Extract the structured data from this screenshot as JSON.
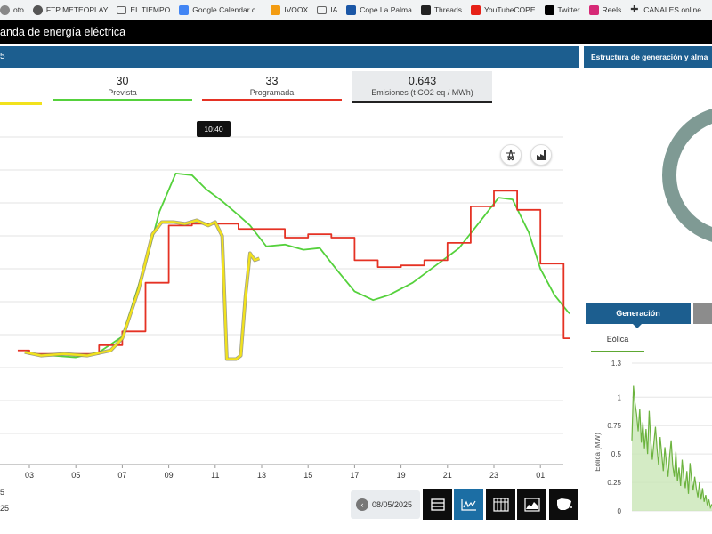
{
  "bookmarks": [
    {
      "label": "oto",
      "icon": "globe-icon",
      "color": "#888888"
    },
    {
      "label": "FTP METEOPLAY",
      "icon": "globe-icon",
      "color": "#555555"
    },
    {
      "label": "EL TIEMPO",
      "icon": "folder-icon",
      "color": "#666666"
    },
    {
      "label": "Google Calendar c...",
      "icon": "calendar-icon",
      "color": "#4285f4"
    },
    {
      "label": "IVOOX",
      "icon": "ivoox-icon",
      "color": "#f39c12"
    },
    {
      "label": "IA",
      "icon": "folder-icon",
      "color": "#666666"
    },
    {
      "label": "Cope La Palma",
      "icon": "cope-icon",
      "color": "#1a56a6"
    },
    {
      "label": "Threads",
      "icon": "threads-icon",
      "color": "#222222"
    },
    {
      "label": "YouTubeCOPE",
      "icon": "youtube-icon",
      "color": "#e62117"
    },
    {
      "label": "Twitter",
      "icon": "x-icon",
      "color": "#000000"
    },
    {
      "label": "Reels",
      "icon": "instagram-icon",
      "color": "#d62976"
    },
    {
      "label": "CANALES online",
      "icon": "plus-icon",
      "color": "#222222"
    }
  ],
  "header": {
    "title": "anda de energía eléctrica",
    "subtitle": "5",
    "right_panel_title": "Estructura de generación y alma"
  },
  "metrics": {
    "real": {
      "value": "",
      "label": "",
      "color": "#f2e21d"
    },
    "prevista": {
      "value": "30",
      "label": "Prevista",
      "color": "#55d13c"
    },
    "programada": {
      "value": "33",
      "label": "Programada",
      "color": "#e53224"
    },
    "emisiones": {
      "value": "0.643",
      "label": "Emisiones (t CO2 eq / MWh)",
      "color": "#222222"
    }
  },
  "tooltip": "10:40",
  "colors": {
    "real": "#f2e21d",
    "real_dark": "#8a8a6a",
    "prevista": "#55d13c",
    "programada": "#e53224",
    "navy": "#1c5e8f",
    "donut": "#7f9a94",
    "eolica": "#6cb33f"
  },
  "chart_data": [
    {
      "type": "line",
      "x_ticks": [
        "03",
        "05",
        "07",
        "09",
        "11",
        "13",
        "15",
        "17",
        "19",
        "21",
        "23",
        "01"
      ],
      "grid": true,
      "series": [
        {
          "name": "Prevista",
          "color": "#55d13c",
          "points": [
            [
              1.0,
              0.73
            ],
            [
              2.0,
              0.72
            ],
            [
              3.0,
              0.71
            ],
            [
              4.0,
              0.74
            ],
            [
              5.0,
              0.83
            ],
            [
              6.0,
              1.25
            ],
            [
              6.6,
              1.55
            ],
            [
              7.3,
              1.77
            ],
            [
              8.0,
              1.76
            ],
            [
              8.6,
              1.68
            ],
            [
              9.3,
              1.61
            ],
            [
              10.0,
              1.53
            ],
            [
              10.5,
              1.47
            ],
            [
              11.2,
              1.35
            ],
            [
              12.0,
              1.36
            ],
            [
              12.8,
              1.33
            ],
            [
              13.5,
              1.34
            ],
            [
              14.2,
              1.22
            ],
            [
              15.0,
              1.09
            ],
            [
              15.8,
              1.04
            ],
            [
              16.5,
              1.07
            ],
            [
              17.5,
              1.14
            ],
            [
              18.5,
              1.24
            ],
            [
              19.5,
              1.34
            ],
            [
              20.5,
              1.51
            ],
            [
              21.2,
              1.63
            ],
            [
              21.8,
              1.62
            ],
            [
              22.5,
              1.43
            ],
            [
              23.0,
              1.22
            ],
            [
              23.6,
              1.07
            ],
            [
              24.2,
              0.97
            ],
            [
              25.0,
              0.89
            ],
            [
              25.5,
              0.83
            ],
            [
              26.0,
              0.78
            ]
          ]
        },
        {
          "name": "Programada",
          "color": "#e53224",
          "step": true,
          "points": [
            [
              0.5,
              0.75
            ],
            [
              1.0,
              0.73
            ],
            [
              4.0,
              0.78
            ],
            [
              5.0,
              0.86
            ],
            [
              6.0,
              1.14
            ],
            [
              7.0,
              1.47
            ],
            [
              8.0,
              1.48
            ],
            [
              9.0,
              1.48
            ],
            [
              10.0,
              1.45
            ],
            [
              12.0,
              1.4
            ],
            [
              13.0,
              1.42
            ],
            [
              14.0,
              1.4
            ],
            [
              15.0,
              1.27
            ],
            [
              16.0,
              1.23
            ],
            [
              17.0,
              1.24
            ],
            [
              18.0,
              1.27
            ],
            [
              19.0,
              1.37
            ],
            [
              20.0,
              1.58
            ],
            [
              21.0,
              1.67
            ],
            [
              22.0,
              1.56
            ],
            [
              23.0,
              1.25
            ],
            [
              24.0,
              0.82
            ],
            [
              25.0,
              0.67
            ],
            [
              26.0,
              0.65
            ]
          ]
        },
        {
          "name": "Real",
          "color": "#f2e21d",
          "points": [
            [
              0.8,
              0.74
            ],
            [
              1.5,
              0.72
            ],
            [
              2.5,
              0.73
            ],
            [
              3.5,
              0.72
            ],
            [
              4.5,
              0.75
            ],
            [
              5.0,
              0.82
            ],
            [
              5.7,
              1.1
            ],
            [
              6.3,
              1.42
            ],
            [
              6.7,
              1.49
            ],
            [
              7.2,
              1.49
            ],
            [
              7.7,
              1.48
            ],
            [
              8.2,
              1.5
            ],
            [
              8.7,
              1.47
            ],
            [
              9.0,
              1.49
            ],
            [
              9.3,
              1.41
            ],
            [
              9.5,
              0.7
            ],
            [
              9.9,
              0.7
            ],
            [
              10.1,
              0.72
            ],
            [
              10.3,
              1.06
            ],
            [
              10.5,
              1.31
            ],
            [
              10.7,
              1.27
            ],
            [
              10.9,
              1.28
            ]
          ]
        }
      ]
    },
    {
      "type": "area",
      "y_ticks": [
        "1.3",
        "1",
        "0.75",
        "0.5",
        "0.25",
        "0"
      ],
      "ylabel": "Eólica (MW)",
      "ylim": [
        0,
        1.3
      ],
      "series": [
        {
          "name": "Eólica",
          "color": "#6cb33f",
          "values": [
            0.62,
            1.1,
            0.95,
            0.85,
            0.7,
            0.9,
            0.6,
            0.78,
            0.55,
            0.72,
            0.5,
            0.88,
            0.62,
            0.45,
            0.6,
            0.74,
            0.55,
            0.4,
            0.65,
            0.5,
            0.35,
            0.56,
            0.42,
            0.3,
            0.48,
            0.62,
            0.4,
            0.3,
            0.52,
            0.26,
            0.38,
            0.22,
            0.45,
            0.3,
            0.2,
            0.35,
            0.15,
            0.42,
            0.28,
            0.18,
            0.3,
            0.2,
            0.12,
            0.25,
            0.1,
            0.2,
            0.08,
            0.14,
            0.05,
            0.1,
            0.03,
            0.06
          ]
        }
      ]
    }
  ],
  "date_nav": {
    "date": "08/05/2025"
  },
  "bottom_left": {
    "line1": "5",
    "line2": "25"
  },
  "generation": {
    "tab_label": "Generación",
    "sub_tab_label": "Eólica"
  }
}
